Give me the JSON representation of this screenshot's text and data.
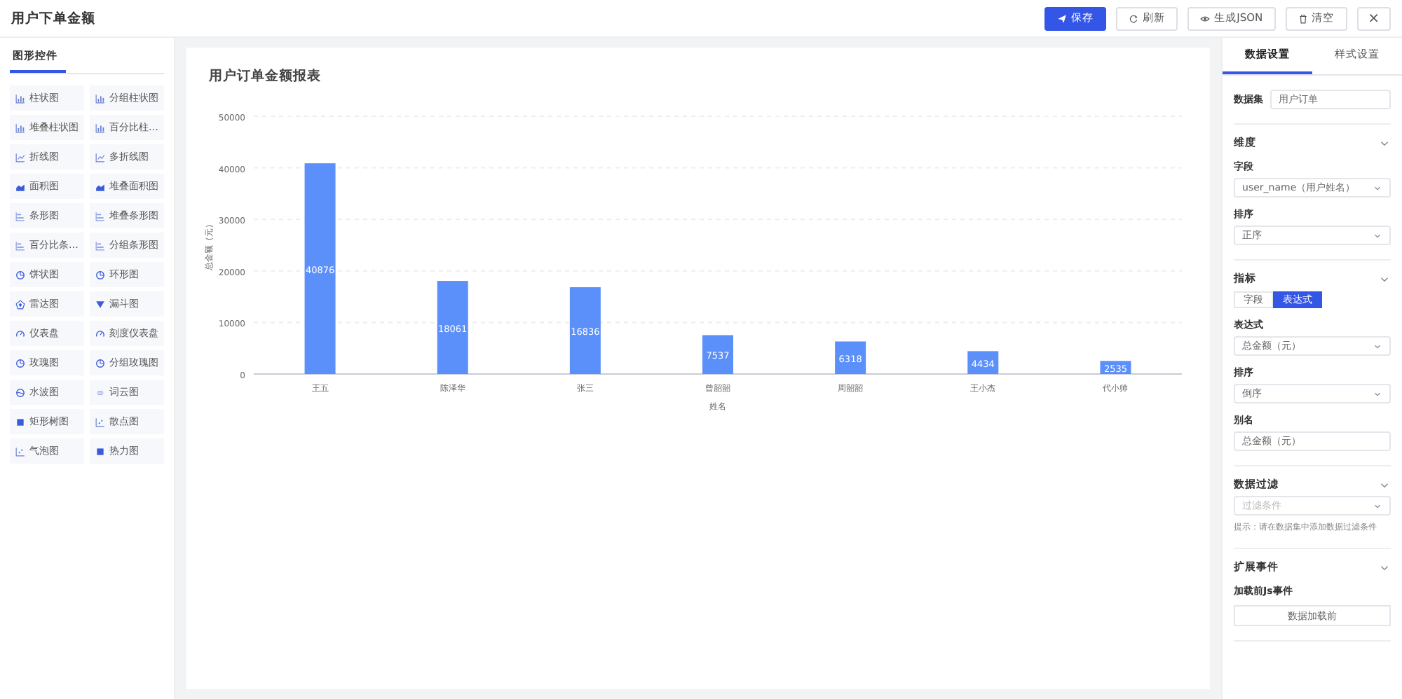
{
  "header": {
    "title": "用户下单金额",
    "buttons": [
      {
        "label": "保存",
        "kind": "send"
      },
      {
        "label": "刷新",
        "kind": "refresh"
      },
      {
        "label": "生成JSON",
        "kind": "eye"
      },
      {
        "label": "清空",
        "kind": "trash"
      }
    ],
    "close": "×"
  },
  "sidebar": {
    "tabs": [
      {
        "label": "图形控件",
        "selected": true
      }
    ],
    "items": [
      {
        "label": "柱状图",
        "kind": "bar"
      },
      {
        "label": "分组柱状图",
        "kind": "bar"
      },
      {
        "label": "堆叠柱状图",
        "kind": "bar"
      },
      {
        "label": "百分比柱...",
        "kind": "bar"
      },
      {
        "label": "折线图",
        "kind": "line"
      },
      {
        "label": "多折线图",
        "kind": "line"
      },
      {
        "label": "面积图",
        "kind": "area"
      },
      {
        "label": "堆叠面积图",
        "kind": "area"
      },
      {
        "label": "条形图",
        "kind": "hbar"
      },
      {
        "label": "堆叠条形图",
        "kind": "hbar"
      },
      {
        "label": "百分比条...",
        "kind": "hbar"
      },
      {
        "label": "分组条形图",
        "kind": "hbar"
      },
      {
        "label": "饼状图",
        "kind": "pie"
      },
      {
        "label": "环形图",
        "kind": "pie"
      },
      {
        "label": "雷达图",
        "kind": "radar"
      },
      {
        "label": "漏斗图",
        "kind": "funnel"
      },
      {
        "label": "仪表盘",
        "kind": "gauge"
      },
      {
        "label": "刻度仪表盘",
        "kind": "gauge"
      },
      {
        "label": "玫瑰图",
        "kind": "pie"
      },
      {
        "label": "分组玫瑰图",
        "kind": "pie"
      },
      {
        "label": "水波图",
        "kind": "water"
      },
      {
        "label": "词云图",
        "kind": "cloud"
      },
      {
        "label": "矩形树图",
        "kind": "square"
      },
      {
        "label": "散点图",
        "kind": "scatter"
      },
      {
        "label": "气泡图",
        "kind": "scatter"
      },
      {
        "label": "热力图",
        "kind": "square"
      }
    ]
  },
  "canvas": {
    "title": "用户订单金额报表",
    "chart_data": {
      "type": "bar",
      "xlabel": "姓名",
      "ylabel": "总金额（元）",
      "categories": [
        "王五",
        "陈泽华",
        "张三",
        "曾韶韶",
        "周韶韶",
        "王小杰",
        "代小帅"
      ],
      "series": [
        {
          "color": "#5b8ff9",
          "values": [
            40876,
            18061,
            16836,
            7537,
            6318,
            4434,
            2535
          ]
        }
      ],
      "ylim": [
        0,
        50000
      ],
      "yticks": [
        0,
        10000,
        20000,
        30000,
        40000,
        50000
      ],
      "grid": true,
      "data_labels": true
    }
  },
  "settings": {
    "tabs": [
      {
        "label": "数据设置",
        "selected": true
      },
      {
        "label": "样式设置",
        "selected": false
      }
    ],
    "dataset": {
      "label": "数据集",
      "value": "用户订单"
    },
    "sections": [
      {
        "title": "维度",
        "expanded": true,
        "rows": [
          {
            "kind": "select",
            "label": "字段",
            "value": "user_name（用户姓名）"
          },
          {
            "kind": "select",
            "label": "排序",
            "value": "正序"
          }
        ]
      },
      {
        "title": "指标",
        "expanded": true,
        "rows": [
          {
            "kind": "toggle",
            "options": [
              {
                "label": "字段",
                "selected": false
              },
              {
                "label": "表达式",
                "selected": true
              }
            ]
          },
          {
            "kind": "select",
            "label": "表达式",
            "value": "总金额（元）"
          },
          {
            "kind": "select",
            "label": "排序",
            "value": "倒序"
          },
          {
            "kind": "input",
            "label": "别名",
            "value": "总金额（元）"
          }
        ]
      },
      {
        "title": "数据过滤",
        "expanded": true,
        "rows": [
          {
            "kind": "select",
            "placeholder": "过滤条件"
          },
          {
            "kind": "hint",
            "text": "提示：请在数据集中添加数据过滤条件"
          }
        ]
      },
      {
        "title": "扩展事件",
        "expanded": true,
        "rows": [
          {
            "kind": "button",
            "label": "加载前Js事件",
            "value": "数据加载前"
          }
        ]
      }
    ]
  }
}
